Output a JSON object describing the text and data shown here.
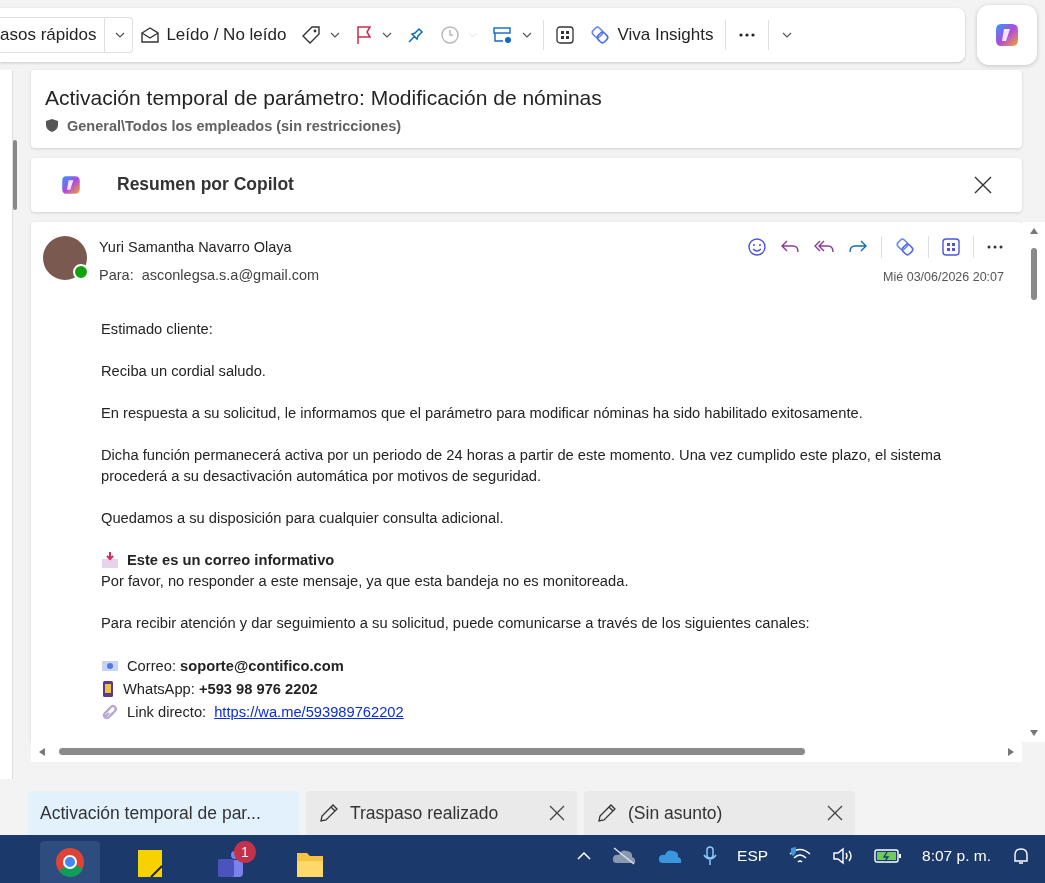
{
  "toolbar": {
    "items": [
      {
        "kind": "quick-steps",
        "label": "asos rápidos",
        "dropdown": true,
        "disabled": false
      },
      {
        "kind": "read",
        "label": "Leído / No leído",
        "dropdown": false,
        "disabled": false
      },
      {
        "kind": "tag",
        "dropdown": true,
        "disabled": false
      },
      {
        "kind": "flag",
        "dropdown": true,
        "disabled": false
      },
      {
        "kind": "pin",
        "dropdown": false,
        "disabled": false
      },
      {
        "kind": "snooze",
        "dropdown": true,
        "disabled": true
      },
      {
        "kind": "rules",
        "dropdown": true,
        "disabled": false
      },
      {
        "kind": "apps",
        "dropdown": false,
        "disabled": false
      },
      {
        "kind": "viva",
        "label": "Viva Insights",
        "dropdown": false,
        "disabled": false
      },
      {
        "kind": "more",
        "dropdown": false,
        "disabled": false
      },
      {
        "kind": "expand",
        "dropdown": true,
        "disabled": false
      }
    ]
  },
  "message": {
    "subject": "Activación temporal de parámetro: Modificación de nóminas",
    "sensitivity": "General\\Todos los empleados (sin restricciones)",
    "copilot_summary": "Resumen por Copilot",
    "sender": "Yuri Samantha Navarro Olaya",
    "to_label": "Para:",
    "to": "asconlegsa.s.a@gmail.com",
    "date": "Mié 03/06/2026 20:07",
    "body": [
      {
        "kind": "text",
        "text": "Estimado cliente:"
      },
      {
        "kind": "text",
        "text": "Reciba un cordial saludo."
      },
      {
        "kind": "text",
        "text": "En respuesta a su solicitud, le informamos que el parámetro para modificar nóminas ha sido habilitado exitosamente."
      },
      {
        "kind": "text",
        "text": "Dicha función permanecerá activa por un periodo de 24 horas a partir de este momento. Una vez cumplido este plazo, el sistema procederá a su desactivación automática por motivos de seguridad."
      },
      {
        "kind": "text",
        "text": "Quedamos a su disposición para cualquier consulta adicional."
      },
      {
        "kind": "notice",
        "title": "Este es un correo informativo",
        "text": "Por favor, no responder a este mensaje, ya que esta bandeja no es monitoreada."
      },
      {
        "kind": "text",
        "text": "Para recibir atención y dar seguimiento a su solicitud, puede comunicarse a través de los siguientes canales:"
      },
      {
        "kind": "contacts",
        "lines": [
          {
            "kind": "email",
            "text": "Correo: **soporte@contifico.com**"
          },
          {
            "kind": "phone",
            "text": "WhatsApp: **+593 98 976 2202**"
          },
          {
            "kind": "link",
            "text": "Link directo:",
            "link": "https://wa.me/593989762202"
          }
        ]
      }
    ]
  },
  "tabs": [
    {
      "kind": "message",
      "label": "Activación temporal de par...",
      "selected": true
    },
    {
      "kind": "draft",
      "label": "Traspaso realizado",
      "selected": false
    },
    {
      "kind": "draft",
      "label": "(Sin asunto)",
      "selected": false
    }
  ],
  "taskbar": {
    "apps": [
      {
        "kind": "browser",
        "active": true
      },
      {
        "kind": "notes",
        "active": false
      },
      {
        "kind": "teams",
        "active": false,
        "badge": "1"
      },
      {
        "kind": "folder",
        "active": false
      }
    ],
    "language": "ESP",
    "time": "8:07 p. m."
  }
}
